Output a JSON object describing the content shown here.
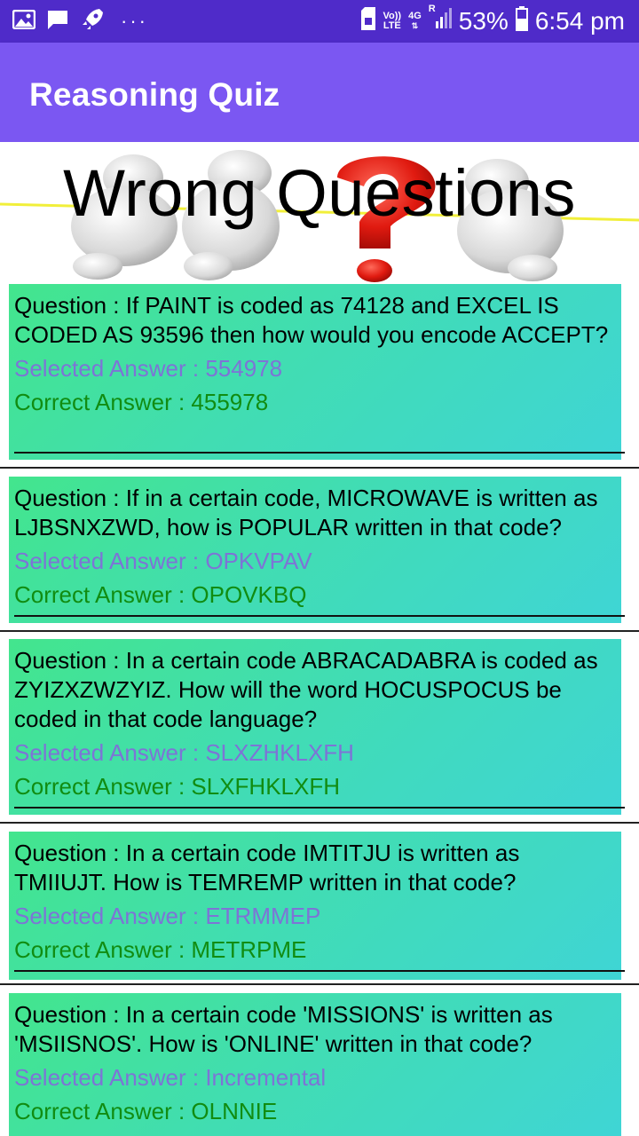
{
  "status_bar": {
    "icons_left": [
      "image-icon",
      "message-icon",
      "rocket-icon",
      "more-dots-icon"
    ],
    "more_dots": "···",
    "volte_top": "Vo))",
    "volte_bottom": "LTE",
    "network": "4G",
    "roaming": "R",
    "battery": "53%",
    "time": "6:54 pm"
  },
  "app_bar": {
    "title": "Reasoning Quiz"
  },
  "banner": {
    "title": "Wrong Questions"
  },
  "questions": [
    {
      "question": "Question : If PAINT is coded as 74128 and EXCEL IS CODED AS 93596 then how would you encode ACCEPT?",
      "selected": "Selected Answer : 554978",
      "correct": "Correct Answer : 455978"
    },
    {
      "question": "Question : If in a certain code, MICROWAVE is written as LJBSNXZWD, how is POPULAR written in that code?",
      "selected": "Selected Answer : OPKVPAV",
      "correct": "Correct Answer : OPOVKBQ"
    },
    {
      "question": "Question : In a certain code ABRACADABRA is coded as ZYIZXZWZYIZ. How will the word HOCUSPOCUS be coded in that code language?",
      "selected": "Selected Answer : SLXZHKLXFH",
      "correct": "Correct Answer : SLXFHKLXFH"
    },
    {
      "question": "Question : In a certain code IMTITJU is written as TMIIUJT. How is TEMREMP written in that code?",
      "selected": "Selected Answer : ETRMMEP",
      "correct": "Correct Answer : METRPME"
    },
    {
      "question": "Question : In a certain code 'MISSIONS' is written as 'MSIISNOS'. How is 'ONLINE' written in that code?",
      "selected": "Selected Answer : Incremental",
      "correct": "Correct Answer : OLNNIE"
    }
  ]
}
